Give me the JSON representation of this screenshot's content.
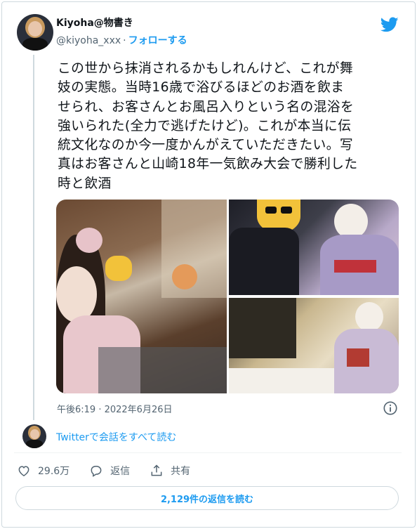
{
  "author": {
    "name": "Kiyoha@物書き",
    "handle": "@kiyoha_xxx",
    "separator": "·",
    "follow_label": "フォローする"
  },
  "tweet": {
    "text": "この世から抹消されるかもしれんけど、これが舞\n妓の実態。当時16歳で浴びるほどのお酒を飲ま\nせられ、お客さんとお風呂入りという名の混浴を\n強いられた(全力で逃げたけど)。これが本当に伝\n統文化なのか今一度かんがえていただきたい。写\n真はお客さんと山崎18年一気飲み大会で勝利した\n時と飲酒",
    "timestamp": "午後6:19 · 2022年6月26日"
  },
  "thread": {
    "read_all_label": "Twitterで会話をすべて読む"
  },
  "actions": {
    "like_count": "29.6万",
    "reply_label": "返信",
    "share_label": "共有"
  },
  "replies_button": {
    "label": "2,129件の返信を読む"
  },
  "colors": {
    "accent": "#1d9bf0",
    "secondary_text": "#536471",
    "border": "#cfd9de"
  },
  "icons": [
    "twitter-bird-icon",
    "info-icon",
    "heart-icon",
    "reply-bubble-icon",
    "share-icon"
  ]
}
